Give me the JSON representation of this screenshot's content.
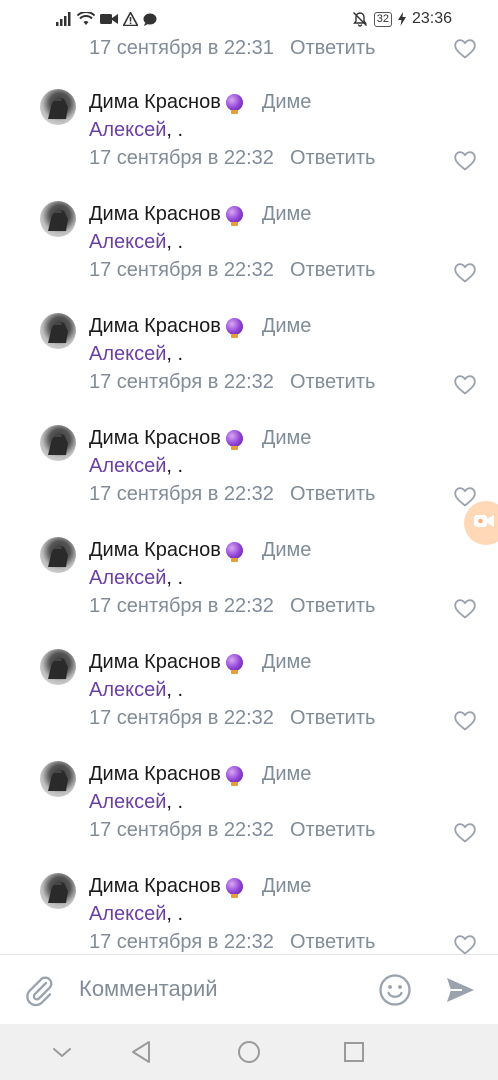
{
  "status_bar": {
    "battery": "32",
    "time": "23:36",
    "left_icons": [
      "signal-icon",
      "wifi-icon",
      "video-icon",
      "warning-icon",
      "chat-icon"
    ],
    "right_icons": [
      "mute-icon",
      "battery-icon",
      "charging-icon"
    ]
  },
  "first_partial": {
    "date": "17 сентября в 22:31",
    "reply_label": "Ответить"
  },
  "comments": [
    {
      "author": "Дима Краснов",
      "reply_to": "Диме",
      "mention": "Алексей",
      "rest": ", .",
      "date": "17 сентября в 22:32",
      "reply_label": "Ответить"
    },
    {
      "author": "Дима Краснов",
      "reply_to": "Диме",
      "mention": "Алексей",
      "rest": ", .",
      "date": "17 сентября в 22:32",
      "reply_label": "Ответить"
    },
    {
      "author": "Дима Краснов",
      "reply_to": "Диме",
      "mention": "Алексей",
      "rest": ", .",
      "date": "17 сентября в 22:32",
      "reply_label": "Ответить"
    },
    {
      "author": "Дима Краснов",
      "reply_to": "Диме",
      "mention": "Алексей",
      "rest": ", .",
      "date": "17 сентября в 22:32",
      "reply_label": "Ответить"
    },
    {
      "author": "Дима Краснов",
      "reply_to": "Диме",
      "mention": "Алексей",
      "rest": ", .",
      "date": "17 сентября в 22:32",
      "reply_label": "Ответить"
    },
    {
      "author": "Дима Краснов",
      "reply_to": "Диме",
      "mention": "Алексей",
      "rest": ", .",
      "date": "17 сентября в 22:32",
      "reply_label": "Ответить"
    },
    {
      "author": "Дима Краснов",
      "reply_to": "Диме",
      "mention": "Алексей",
      "rest": ", .",
      "date": "17 сентября в 22:32",
      "reply_label": "Ответить"
    },
    {
      "author": "Дима Краснов",
      "reply_to": "Диме",
      "mention": "Алексей",
      "rest": ", .",
      "date": "17 сентября в 22:32",
      "reply_label": "Ответить"
    }
  ],
  "input_bar": {
    "placeholder": "Комментарий"
  },
  "colors": {
    "mention": "#6b3fa3",
    "muted": "#818c99",
    "send": "#99a2ad",
    "float_button": "#ffd8b8"
  }
}
